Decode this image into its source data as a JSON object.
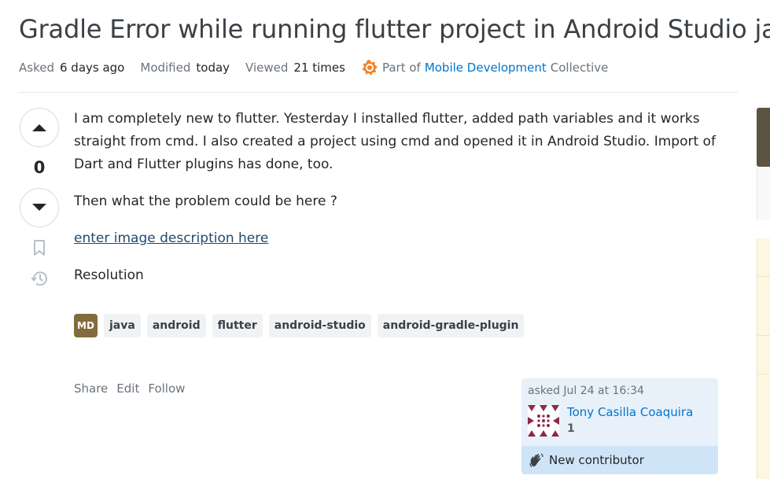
{
  "question": {
    "title": "Gradle Error while running flutter project in Android Studio java",
    "meta": {
      "asked_label": "Asked",
      "asked_value": "6 days ago",
      "modified_label": "Modified",
      "modified_value": "today",
      "viewed_label": "Viewed",
      "viewed_value": "21 times",
      "part_of": "Part of",
      "collective_link": "Mobile Development",
      "collective_suffix": "Collective"
    },
    "vote_count": "0",
    "body": {
      "p1": "I am completely new to flutter. Yesterday I installed flutter, added path variables and it works straight from cmd. I also created a project using cmd and opened it in Android Studio. Import of Dart and Flutter plugins has done, too.",
      "p2": "Then what the problem could be here ?",
      "image_link": "enter image description here",
      "p3": "Resolution"
    },
    "collective_badge": "MD",
    "tags": [
      "java",
      "android",
      "flutter",
      "android-studio",
      "android-gradle-plugin"
    ],
    "actions": {
      "share": "Share",
      "edit": "Edit",
      "follow": "Follow"
    }
  },
  "user_card": {
    "asked": "asked Jul 24 at 16:34",
    "name": "Tony Casilla Coaquira",
    "reputation": "1",
    "new_contributor": "New contributor"
  },
  "icons": {
    "upvote": "upvote-arrow-icon",
    "downvote": "downvote-arrow-icon",
    "bookmark": "bookmark-icon",
    "history": "history-icon",
    "collective": "collective-badge-icon",
    "wave": "waving-hand-icon"
  },
  "colors": {
    "link": "#0074cc",
    "collective_badge": "#826c3d",
    "tag_bg": "#f1f2f3",
    "usercard_bg": "#e8f1fa",
    "new_contributor_bg": "#cfe4f7"
  }
}
